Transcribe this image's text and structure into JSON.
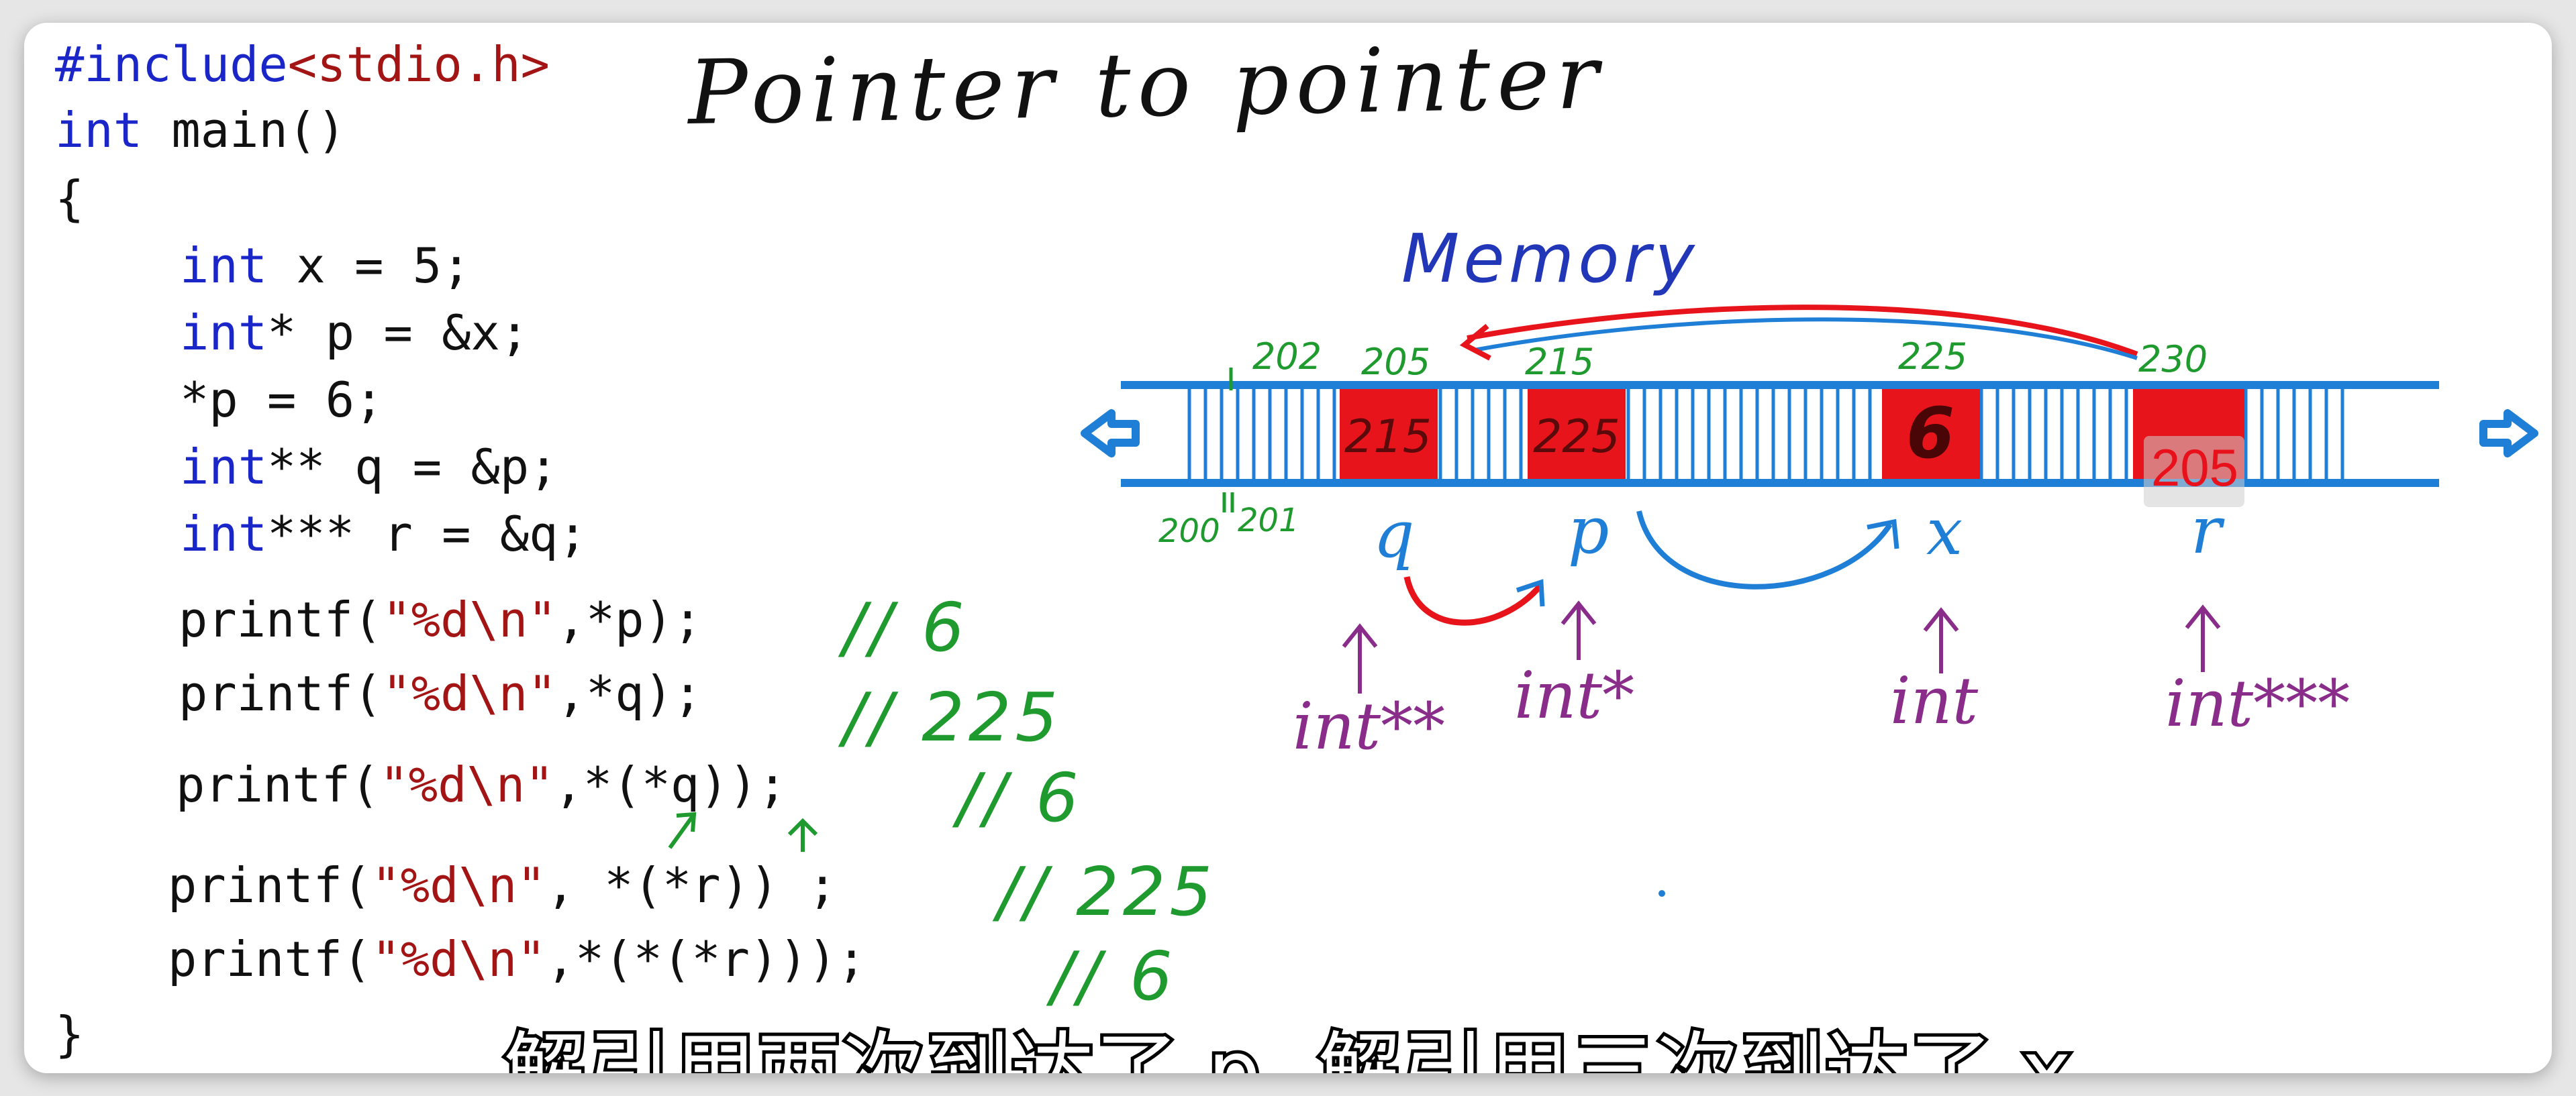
{
  "code": {
    "line1": {
      "pre": "#include",
      "inc": "<stdio.h>"
    },
    "line2": {
      "kw": "int",
      "rest": " main()"
    },
    "line3": "{",
    "line4": {
      "kw": "int",
      "rest": " x = 5;"
    },
    "line5": {
      "kw": "int",
      "rest": "* p = &x;"
    },
    "line6": "*p = 6;",
    "line7": {
      "kw": "int",
      "rest": "** q = &p;"
    },
    "line8": {
      "kw": "int",
      "rest": "*** r = &q;"
    },
    "line9": {
      "a": "printf(",
      "s": "\"%d\\n\"",
      "b": ",*p);"
    },
    "line10": {
      "a": "printf(",
      "s": "\"%d\\n\"",
      "b": ",*q);"
    },
    "line11": {
      "a": "printf(",
      "s": "\"%d\\n\"",
      "b": ",*(*q));"
    },
    "line12": {
      "a": "printf(",
      "s": "\"%d\\n\"",
      "b": ", *(*r)) ;"
    },
    "line13": {
      "a": "printf(",
      "s": "\"%d\\n\"",
      "b": ",*(*(*r)));"
    },
    "line14": "}"
  },
  "annotations": {
    "title": "Pointer to pointer",
    "memory_label": "Memory",
    "outputs": [
      "// 6",
      "// 225",
      "// 6",
      "// 225",
      "// 6"
    ],
    "addresses": {
      "a202": "202",
      "a205": "205",
      "a215": "215",
      "a225": "225",
      "a230": "230",
      "a200": "200",
      "a201": "201"
    },
    "cell_values": {
      "q_cell": "215",
      "p_cell": "225",
      "x_cell": "6"
    },
    "var_names": {
      "q": "q",
      "p": "p",
      "x": "x",
      "r": "r"
    },
    "types": {
      "q": "int**",
      "p": "int*",
      "x": "int",
      "r": "int***"
    }
  },
  "overlay": {
    "value": "205"
  },
  "subtitle": "解引用两次到达了 p, 解引用三次到达了 x",
  "colors": {
    "keyword": "#1a26c7",
    "string": "#a31515",
    "ink_black": "#111111",
    "ink_green": "#1f9a2e",
    "ink_blue": "#1f7fd6",
    "ink_purple": "#8a2c8a",
    "cell_red": "#e8141c",
    "memory_label": "#2236b8"
  }
}
